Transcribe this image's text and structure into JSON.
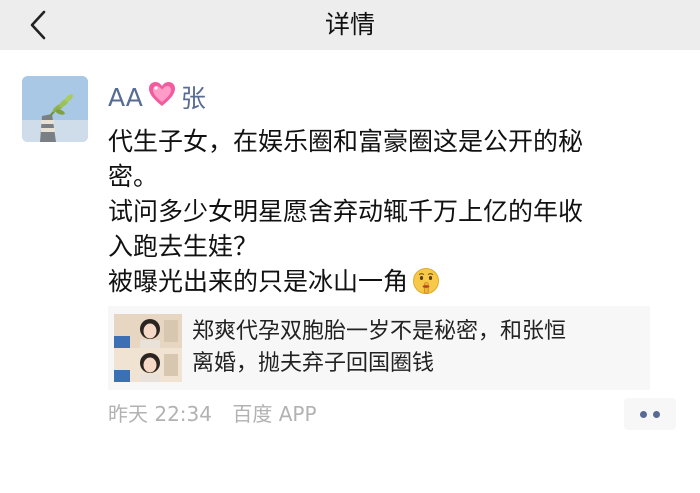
{
  "nav": {
    "title": "详情",
    "back_icon": "chevron-left-icon"
  },
  "post": {
    "author": {
      "name_prefix": "AA",
      "heart_icon": "sparkling-heart-icon",
      "name_suffix": "张",
      "avatar_icon": "avatar-photo",
      "name_color": "#576b95"
    },
    "text_lines": [
      "代生子女，在娱乐圈和富豪圈这是公开的秘",
      "密。",
      "试问多少女明星愿舍弃动辄千万上亿的年收",
      "入跑去生娃？",
      "被曝光出来的只是冰山一角"
    ],
    "emoji": "shushing-face-icon",
    "shared_link": {
      "thumbnail_icon": "news-thumbnail",
      "title_lines": [
        "郑爽代孕双胞胎一岁不是秘密，和张恒",
        "离婚，抛夫弃子回国圈钱"
      ]
    },
    "meta": {
      "time": "昨天 22:34",
      "source": "百度 APP"
    },
    "more_icon": "more-dots-icon"
  }
}
